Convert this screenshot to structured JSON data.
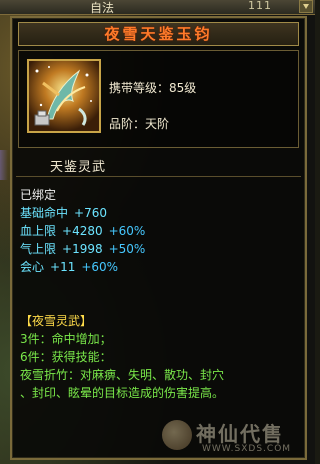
{
  "background": {
    "top_label": "自法",
    "top_count": "111"
  },
  "tooltip": {
    "title": "夜雪天鉴玉钧",
    "level_label": "携带等级：",
    "level_value": "85级",
    "tier_label": "品阶：",
    "tier_value": "天阶",
    "weapon_type": "天鉴灵武",
    "bound_status": "已绑定",
    "stats": [
      {
        "name": "基础命中",
        "base": "+760",
        "bonus": ""
      },
      {
        "name": "血上限",
        "base": "+4280",
        "bonus": "+60%"
      },
      {
        "name": "气上限",
        "base": "+1998",
        "bonus": "+50%"
      },
      {
        "name": "会心",
        "base": "+11",
        "bonus": "+60%"
      }
    ],
    "set": {
      "name": "【夜雪灵武】",
      "piece3": "3件：命中增加；",
      "piece6": "6件：获得技能：",
      "skill_line1": "夜雪折竹：对麻痹、失明、散功、封穴",
      "skill_line2": "、封印、眩晕的目标造成的伤害提高。"
    }
  },
  "watermark": {
    "text": "神仙代售",
    "url": "WWW.SXDS.COM"
  },
  "colors": {
    "title": "#ff7a2a",
    "stat_name": "#6ce4ff",
    "bonus": "#46c8ff",
    "set_name": "#ffdc4a",
    "set_text": "#7ae84a",
    "border": "#7a6a3a"
  },
  "icons": {
    "item": "jade-hook-weapon-icon",
    "watermark_logo": "mascot-logo-icon"
  }
}
